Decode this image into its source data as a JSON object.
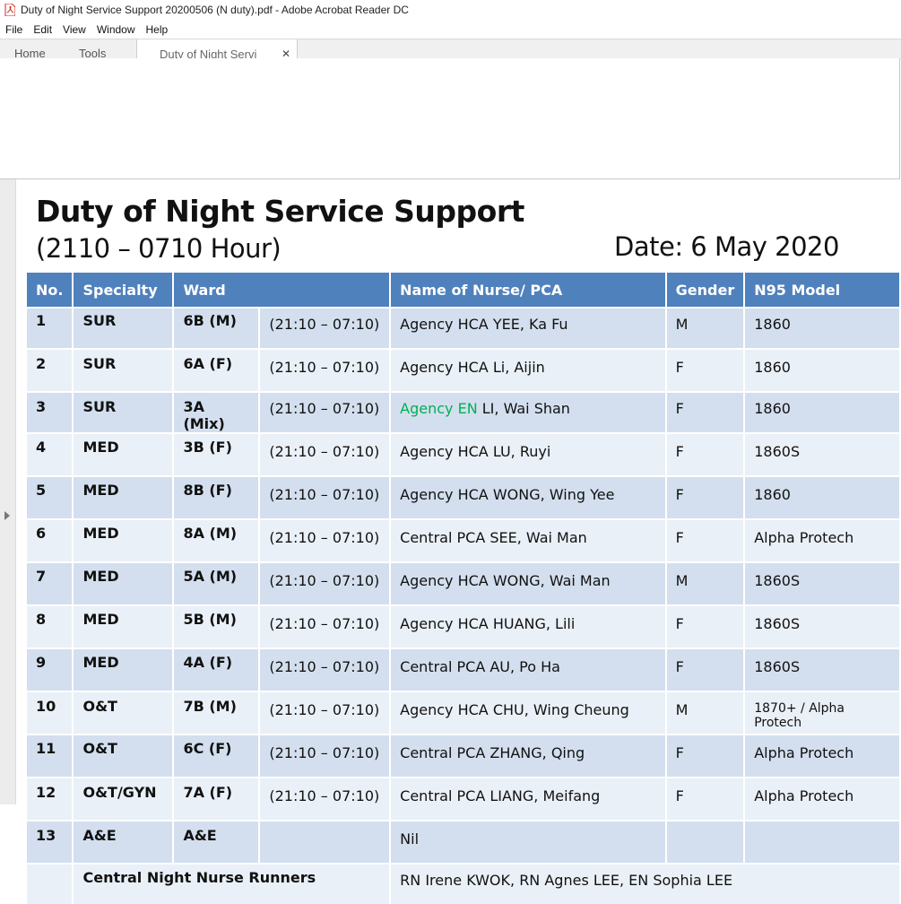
{
  "window": {
    "title": "Duty of Night Service Support 20200506 (N duty).pdf - Adobe Acrobat Reader DC"
  },
  "menu": [
    "File",
    "Edit",
    "View",
    "Window",
    "Help"
  ],
  "tabs": {
    "home": "Home",
    "tools": "Tools",
    "document": "Duty of Night Servi"
  },
  "doc": {
    "title": "Duty of Night Service Support",
    "hours": "(2110 – 0710 Hour)",
    "date": "Date: 6 May 2020",
    "headers": {
      "no": "No.",
      "specialty": "Specialty",
      "ward": "Ward",
      "name": "Name of Nurse/ PCA",
      "gender": "Gender",
      "n95": "N95 Model"
    },
    "rows": [
      {
        "no": "1",
        "specialty": "SUR",
        "ward": "6B (M)",
        "time": "(21:10 – 07:10)",
        "name_prefix": "",
        "name": "Agency HCA YEE, Ka Fu",
        "gender": "M",
        "n95": "1860"
      },
      {
        "no": "2",
        "specialty": "SUR",
        "ward": "6A (F)",
        "time": "(21:10 – 07:10)",
        "name_prefix": "",
        "name": "Agency HCA Li, Aijin",
        "gender": "F",
        "n95": "1860"
      },
      {
        "no": "3",
        "specialty": "SUR",
        "ward": "3A (Mix)",
        "time": "(21:10 – 07:10)",
        "name_prefix": "Agency EN",
        "name": " LI, Wai Shan",
        "gender": "F",
        "n95": "1860"
      },
      {
        "no": "4",
        "specialty": "MED",
        "ward": "3B (F)",
        "time": "(21:10 – 07:10)",
        "name_prefix": "",
        "name": "Agency HCA LU, Ruyi",
        "gender": "F",
        "n95": "1860S"
      },
      {
        "no": "5",
        "specialty": "MED",
        "ward": "8B (F)",
        "time": "(21:10 – 07:10)",
        "name_prefix": "",
        "name": "Agency HCA WONG, Wing Yee",
        "gender": "F",
        "n95": "1860"
      },
      {
        "no": "6",
        "specialty": "MED",
        "ward": "8A (M)",
        "time": "(21:10 – 07:10)",
        "name_prefix": "",
        "name": "Central PCA SEE, Wai Man",
        "gender": "F",
        "n95": "Alpha Protech"
      },
      {
        "no": "7",
        "specialty": "MED",
        "ward": "5A (M)",
        "time": "(21:10 – 07:10)",
        "name_prefix": "",
        "name": "Agency HCA WONG, Wai Man",
        "gender": "M",
        "n95": "1860S"
      },
      {
        "no": "8",
        "specialty": "MED",
        "ward": "5B (M)",
        "time": "(21:10 – 07:10)",
        "name_prefix": "",
        "name": "Agency HCA HUANG, Lili",
        "gender": "F",
        "n95": "1860S"
      },
      {
        "no": "9",
        "specialty": "MED",
        "ward": "4A (F)",
        "time": "(21:10 – 07:10)",
        "name_prefix": "",
        "name": "Central PCA AU, Po Ha",
        "gender": "F",
        "n95": "1860S"
      },
      {
        "no": "10",
        "specialty": "O&T",
        "ward": "7B (M)",
        "time": "(21:10 – 07:10)",
        "name_prefix": "",
        "name": "Agency HCA CHU, Wing Cheung",
        "gender": "M",
        "n95": "1870+ / Alpha Protech"
      },
      {
        "no": "11",
        "specialty": "O&T",
        "ward": "6C (F)",
        "time": "(21:10 – 07:10)",
        "name_prefix": "",
        "name": "Central PCA ZHANG, Qing",
        "gender": "F",
        "n95": "Alpha Protech"
      },
      {
        "no": "12",
        "specialty": "O&T/GYN",
        "ward": "7A (F)",
        "time": "(21:10 – 07:10)",
        "name_prefix": "",
        "name": "Central PCA LIANG, Meifang",
        "gender": "F",
        "n95": "Alpha Protech"
      },
      {
        "no": "13",
        "specialty": "A&E",
        "ward": "A&E",
        "time": "",
        "name_prefix": "",
        "name": "Nil",
        "gender": "",
        "n95": ""
      }
    ],
    "runners": {
      "label": "Central Night Nurse Runners",
      "names": "RN Irene KWOK, RN Agnes LEE, EN Sophia LEE"
    }
  },
  "colors": {
    "header_bg": "#4f81bd",
    "row_dark": "#d3dfee",
    "row_light": "#eaf0f7",
    "highlight_text": "#00b050"
  }
}
